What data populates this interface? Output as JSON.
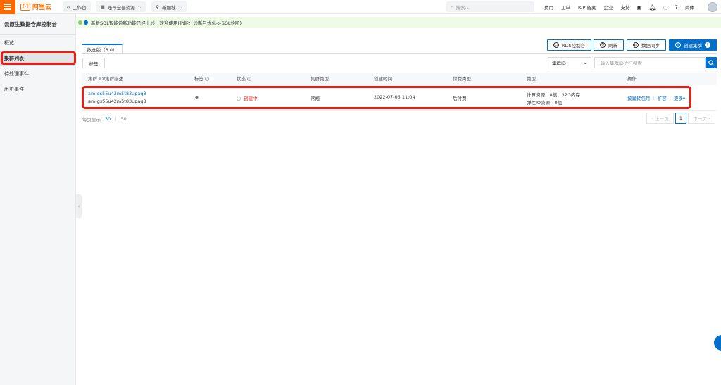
{
  "topbar": {
    "logo_symbol": "[-]",
    "logo_text": "阿里云",
    "workbench": "工作台",
    "account_resources": "账号全部资源",
    "region": "新加坡",
    "search_placeholder": "搜索...",
    "links": [
      "费用",
      "工单",
      "ICP 备案",
      "企业",
      "支持"
    ],
    "language": "简体"
  },
  "sidebar": {
    "title": "云原生数据仓库控制台",
    "items": [
      {
        "label": "概览"
      },
      {
        "label": "集群列表"
      },
      {
        "label": "待处理事件"
      },
      {
        "label": "历史事件"
      }
    ]
  },
  "notice": {
    "text": "新版SQL智能诊断功能已经上线，欢迎使用(功能：诊断与优化->SQL诊断)"
  },
  "tabs": [
    {
      "label": "数仓版（3.0）"
    }
  ],
  "toolbar": {
    "rds_console": "RDS控制台",
    "refresh": "刷新",
    "data_sync": "数据同步",
    "create_cluster": "创建集群",
    "tag_button": "标签",
    "filter_select": "集群ID",
    "search_placeholder": "输入集群ID进行搜索"
  },
  "table": {
    "headers": [
      "集群 ID/集群描述",
      "标签",
      "状态",
      "集群类型",
      "创建时间",
      "付费类型",
      "类型",
      "操作"
    ],
    "rows": [
      {
        "cluster_id": "am-gs55u42m5t83upaq8",
        "description": "am-gs55u42m5t83upaq8",
        "status": "创建中",
        "cluster_type": "常规",
        "created": "2022-07-05 11:04",
        "billing": "后付费",
        "compute": "计算资源：8核，32G内存",
        "elastic_io": "弹性IO资源：0组",
        "actions": {
          "switch": "按量转包月",
          "scale": "扩容",
          "more": "更多"
        }
      }
    ]
  },
  "pagination": {
    "per_page_label": "每页显示",
    "sizes": [
      "30",
      "50"
    ],
    "prev": "上一页",
    "current": "1",
    "next": "下一页"
  },
  "colors": {
    "brand": "#ff6a00",
    "primary": "#0070cc",
    "highlight": "#ee1d11",
    "notice_bg": "#eefbe7"
  }
}
